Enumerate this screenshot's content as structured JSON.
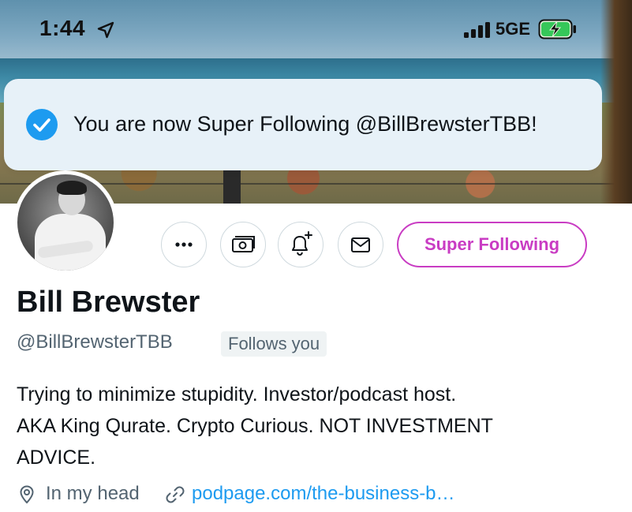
{
  "status_bar": {
    "time": "1:44",
    "network": "5GE",
    "icons": [
      "location-arrow-icon",
      "cellular-signal-icon",
      "battery-charging-icon"
    ]
  },
  "toast": {
    "icon": "checkmark-circle-icon",
    "message": "You are now Super Following @BillBrewsterTBB!",
    "accent_color": "#1d9bf0"
  },
  "profile": {
    "display_name": "Bill Brewster",
    "handle": "@BillBrewsterTBB",
    "follows_you_badge": "Follows you",
    "bio_lines": [
      "Trying to minimize stupidity. Investor/podcast host.",
      "AKA King Qurate. Crypto Curious. NOT INVESTMENT",
      "ADVICE."
    ],
    "location": "In my head",
    "link": "podpage.com/the-business-b…"
  },
  "actions": {
    "more_icon": "more-dots-icon",
    "tip_icon": "money-icon",
    "notify_icon": "bell-plus-icon",
    "message_icon": "envelope-icon",
    "super_following_label": "Super Following",
    "super_following_color": "#c93cc3"
  }
}
